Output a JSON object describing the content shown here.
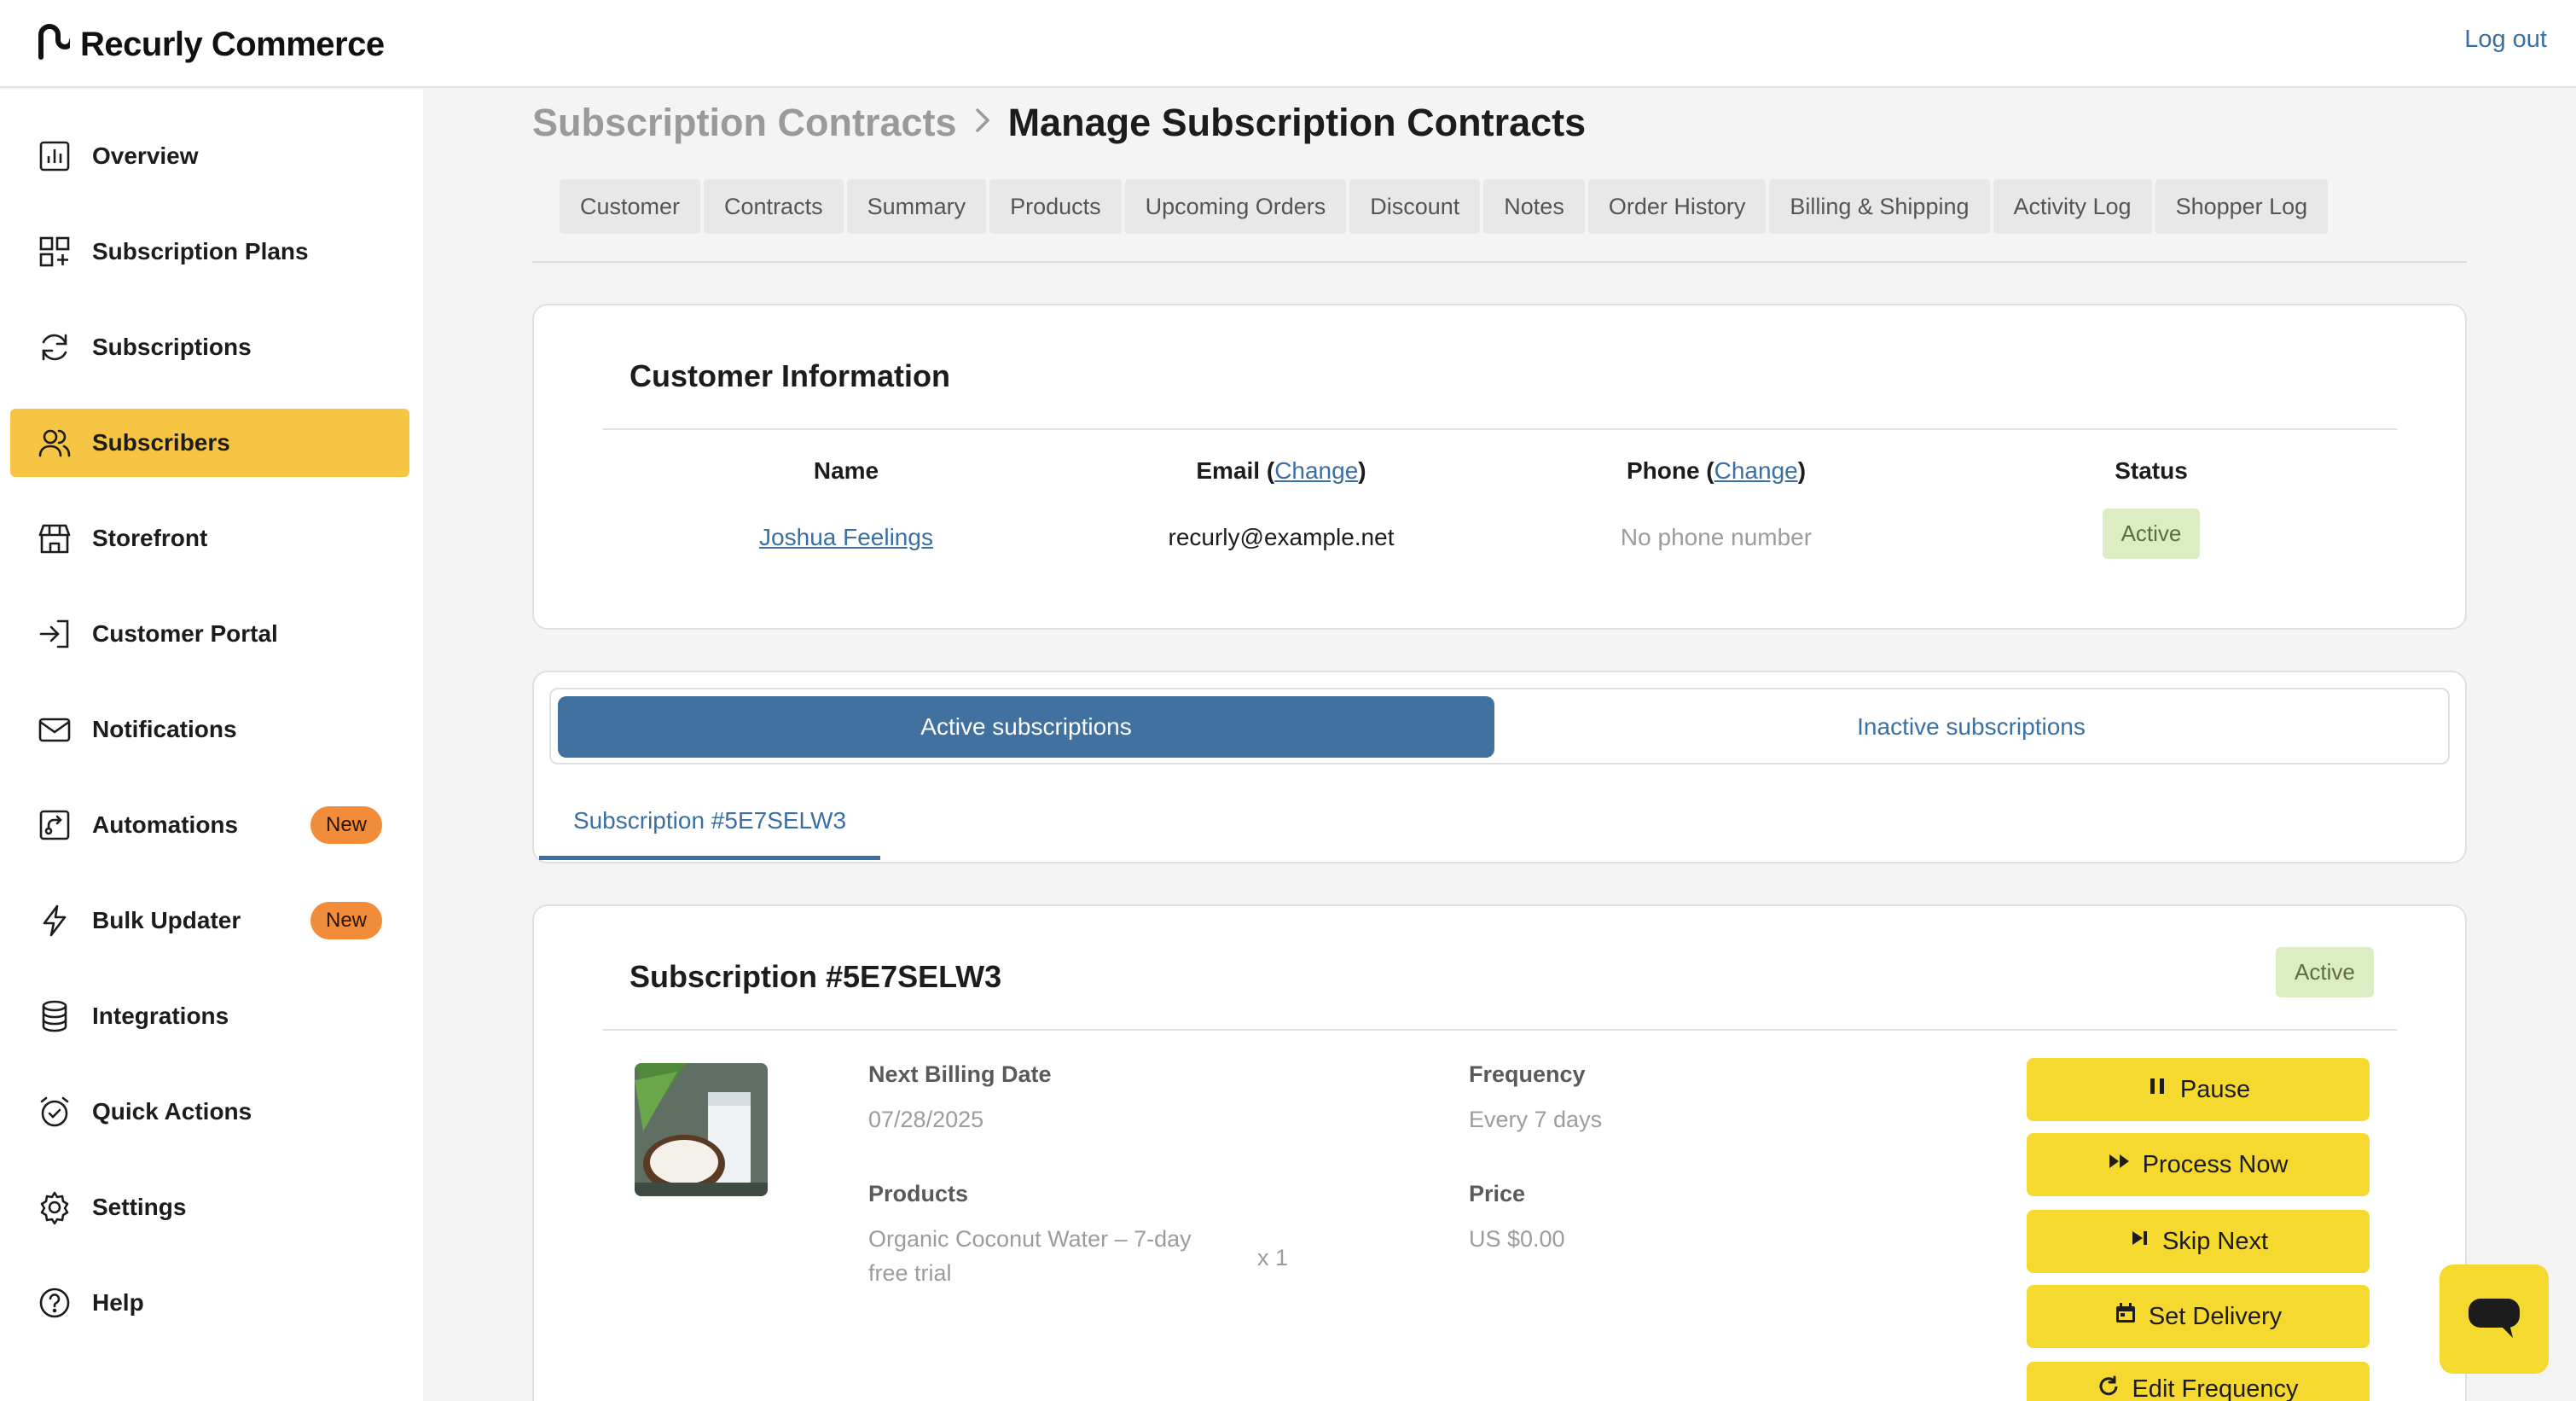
{
  "brand": {
    "name": "Recurly Commerce",
    "logo_icon": "recurly-logo-icon"
  },
  "header": {
    "logout_label": "Log out"
  },
  "sidebar": {
    "items": [
      {
        "label": "Overview",
        "icon": "bar-chart-icon"
      },
      {
        "label": "Subscription Plans",
        "icon": "grid-plus-icon"
      },
      {
        "label": "Subscriptions",
        "icon": "refresh-icon"
      },
      {
        "label": "Subscribers",
        "icon": "users-icon",
        "active": true
      },
      {
        "label": "Storefront",
        "icon": "store-icon"
      },
      {
        "label": "Customer Portal",
        "icon": "login-icon"
      },
      {
        "label": "Notifications",
        "icon": "envelope-icon"
      },
      {
        "label": "Automations",
        "icon": "automation-icon",
        "badge": "New"
      },
      {
        "label": "Bulk Updater",
        "icon": "lightning-icon",
        "badge": "New"
      },
      {
        "label": "Integrations",
        "icon": "database-icon"
      },
      {
        "label": "Quick Actions",
        "icon": "alarm-check-icon"
      },
      {
        "label": "Settings",
        "icon": "gear-icon"
      },
      {
        "label": "Help",
        "icon": "help-circle-icon"
      }
    ],
    "active_color": "#f6c544",
    "badge_color": "#f08c3a"
  },
  "breadcrumb": {
    "parent": "Subscription Contracts",
    "current": "Manage Subscription Contracts"
  },
  "tabs": [
    "Customer",
    "Contracts",
    "Summary",
    "Products",
    "Upcoming Orders",
    "Discount",
    "Notes",
    "Order History",
    "Billing & Shipping",
    "Activity Log",
    "Shopper Log"
  ],
  "customer_info": {
    "title": "Customer Information",
    "name_header": "Name",
    "email_header": "Email",
    "phone_header": "Phone",
    "change_label": "Change",
    "status_header": "Status",
    "name": "Joshua Feelings",
    "email": "recurly@example.net",
    "phone": "No phone number",
    "status": "Active"
  },
  "subscription_toggle": {
    "active_label": "Active subscriptions",
    "inactive_label": "Inactive subscriptions",
    "selected_tab": "Subscription #5E7SELW3",
    "accent": "#40719f"
  },
  "subscription": {
    "title": "Subscription #5E7SELW3",
    "status": "Active",
    "next_billing_label": "Next Billing Date",
    "next_billing_value": "07/28/2025",
    "frequency_label": "Frequency",
    "frequency_value": "Every 7 days",
    "products_label": "Products",
    "product_name": "Organic Coconut Water – 7-day free trial",
    "product_qty": "x 1",
    "price_label": "Price",
    "price_value": "US $0.00",
    "product_image": "coconut-water-product-image"
  },
  "actions": {
    "pause": "Pause",
    "process_now": "Process Now",
    "skip_next": "Skip Next",
    "set_delivery": "Set Delivery",
    "edit_frequency": "Edit Frequency",
    "button_color": "#f6d92f"
  },
  "chat": {
    "icon": "chat-bubble-icon"
  }
}
